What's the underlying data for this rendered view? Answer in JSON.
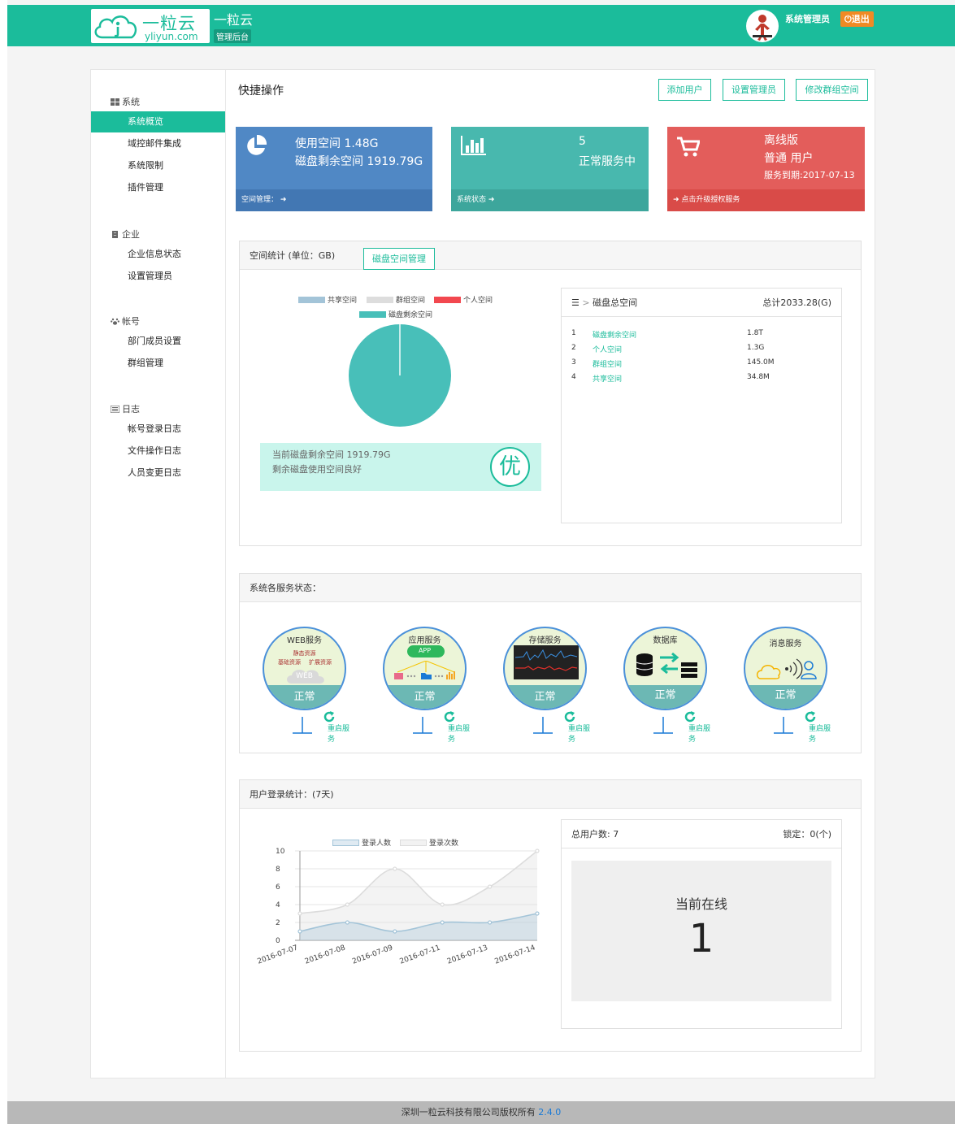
{
  "header": {
    "logo_cn": "一粒云",
    "logo_en": "yliyun.com",
    "title": "一粒云",
    "subtitle": "管理后台",
    "admin_name": "系统管理员",
    "logout_label": "退出",
    "colors": {
      "brand": "#1bbc9b",
      "logout": "#f08a24"
    }
  },
  "sidebar": {
    "sections": [
      {
        "label": "系统",
        "icon": "grid-icon",
        "items": [
          "系统概览",
          "域控邮件集成",
          "系统限制",
          "插件管理"
        ]
      },
      {
        "label": "企业",
        "icon": "building-icon",
        "items": [
          "企业信息状态",
          "设置管理员"
        ]
      },
      {
        "label": "帐号",
        "icon": "paw-icon",
        "items": [
          "部门成员设置",
          "群组管理"
        ]
      },
      {
        "label": "日志",
        "icon": "list-icon",
        "items": [
          "帐号登录日志",
          "文件操作日志",
          "人员变更日志"
        ]
      }
    ],
    "active_item": "系统概览"
  },
  "quick": {
    "title": "快捷操作",
    "buttons": [
      "添加用户",
      "设置管理员",
      "修改群组空间"
    ]
  },
  "tiles": [
    {
      "line1": "使用空间 1.48G",
      "line2": "磁盘剩余空间 1919.79G",
      "footer": "空间管理：",
      "icon": "pie-chart-icon",
      "color": "#5088c5"
    },
    {
      "line1": "5",
      "line2": "正常服务中",
      "footer": "系统状态",
      "icon": "bar-chart-icon",
      "color": "#48b8ae"
    },
    {
      "line1": "离线版",
      "line2": "普通 用户",
      "line3": "服务到期:2017-07-13",
      "footer": "点击升级授权服务",
      "icon": "cart-icon",
      "color": "#e35d5b"
    }
  ],
  "space": {
    "header": "空间统计 (单位：GB)",
    "manage_button": "磁盘空间管理",
    "status_line1": "当前磁盘剩余空间 1919.79G",
    "status_line2": "剩余磁盘使用空间良好",
    "grade": "优",
    "breakdown_title": "磁盘总空间",
    "breakdown_total": "总计2033.28(G)",
    "rows": [
      {
        "n": "1",
        "label": "磁盘剩余空间",
        "value": "1.8T"
      },
      {
        "n": "2",
        "label": "个人空间",
        "value": "1.3G"
      },
      {
        "n": "3",
        "label": "群组空间",
        "value": "145.0M"
      },
      {
        "n": "4",
        "label": "共享空间",
        "value": "34.8M"
      }
    ]
  },
  "services": {
    "header": "系统各服务状态：",
    "restart_label": "重启服务",
    "items": [
      {
        "name": "WEB服务",
        "status": "正常",
        "sub1": "静态资源",
        "sub2": "基础资源",
        "sub3": "扩展资源",
        "tag": "WEB"
      },
      {
        "name": "应用服务",
        "status": "正常",
        "tag": "APP"
      },
      {
        "name": "存储服务",
        "status": "正常"
      },
      {
        "name": "数据库",
        "status": "正常"
      },
      {
        "name": "消息服务",
        "status": "正常"
      }
    ]
  },
  "login": {
    "header": "用户登录统计：(7天)",
    "total_users": "总用户数: 7",
    "locked": "锁定：0(个)",
    "online_label": "当前在线",
    "online_count": "1"
  },
  "chart_data": [
    {
      "type": "pie",
      "labels": [
        "共享空间",
        "群组空间",
        "个人空间",
        "磁盘剩余空间"
      ],
      "values": [
        0.0348,
        0.145,
        1.3,
        1919.79
      ],
      "colors": [
        "#a3c4d8",
        "#dddddd",
        "#f2484f",
        "#48bfb9"
      ]
    },
    {
      "type": "line",
      "x": [
        "2016-07-07",
        "2016-07-08",
        "2016-07-09",
        "2016-07-11",
        "2016-07-13",
        "2016-07-14"
      ],
      "series": [
        {
          "name": "登录人数",
          "values": [
            1,
            2,
            1,
            2,
            2,
            3
          ],
          "color": "#a3c4d8"
        },
        {
          "name": "登录次数",
          "values": [
            3,
            4,
            8,
            4,
            6,
            10
          ],
          "color": "#dcdcdc"
        }
      ],
      "ylim": [
        0,
        10
      ],
      "yticks": [
        0,
        2,
        4,
        6,
        8,
        10
      ],
      "grid": true,
      "legend": "top"
    }
  ]
}
